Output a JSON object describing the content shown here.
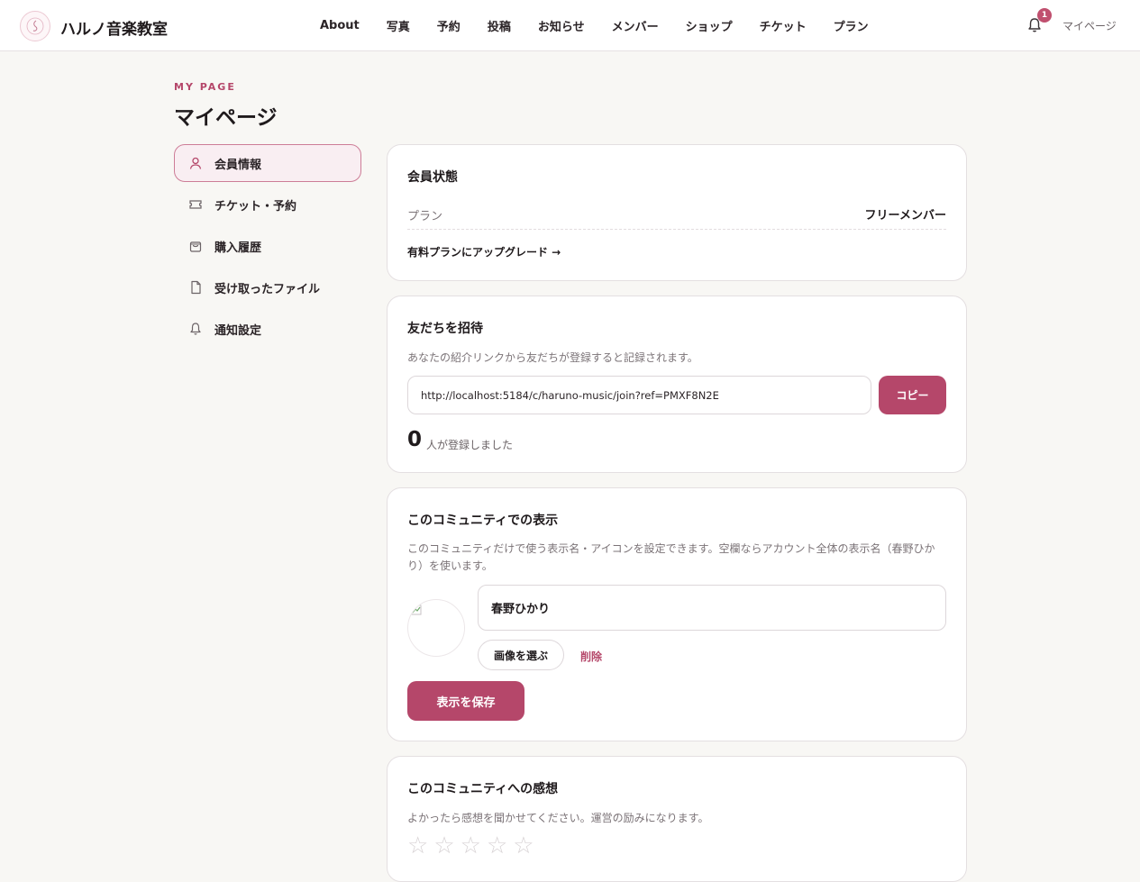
{
  "header": {
    "brand": "ハルノ音楽教室",
    "nav": [
      "About",
      "写真",
      "予約",
      "投稿",
      "お知らせ",
      "メンバー",
      "ショップ",
      "チケット",
      "プラン"
    ],
    "notification_count": "1",
    "mypage_link": "マイページ"
  },
  "page": {
    "eyebrow": "MY PAGE",
    "title": "マイページ"
  },
  "sidebar": {
    "items": [
      {
        "label": "会員情報",
        "icon": "user-icon",
        "active": true
      },
      {
        "label": "チケット・予約",
        "icon": "ticket-icon",
        "active": false
      },
      {
        "label": "購入履歴",
        "icon": "shopping-bag-icon",
        "active": false
      },
      {
        "label": "受け取ったファイル",
        "icon": "file-icon",
        "active": false
      },
      {
        "label": "通知設定",
        "icon": "bell-icon",
        "active": false
      }
    ]
  },
  "membership": {
    "title": "会員状態",
    "plan_label": "プラン",
    "plan_value": "フリーメンバー",
    "upgrade_link": "有料プランにアップグレード →"
  },
  "invite": {
    "title": "友だちを招待",
    "description": "あなたの紹介リンクから友だちが登録すると記録されます。",
    "url": "http://localhost:5184/c/haruno-music/join?ref=PMXF8N2E",
    "copy_label": "コピー",
    "count": "0",
    "count_label": "人が登録しました"
  },
  "display": {
    "title": "このコミュニティでの表示",
    "description": "このコミュニティだけで使う表示名・アイコンを設定できます。空欄ならアカウント全体の表示名（春野ひかり）を使います。",
    "name_value": "春野ひかり",
    "pick_image_label": "画像を選ぶ",
    "delete_label": "削除",
    "save_label": "表示を保存"
  },
  "feedback": {
    "title": "このコミュニティへの感想",
    "description": "よかったら感想を聞かせてください。運営の励みになります。",
    "rating": 0,
    "max_rating": 5
  },
  "colors": {
    "accent": "#b5476a",
    "background": "#f8f7f4"
  }
}
